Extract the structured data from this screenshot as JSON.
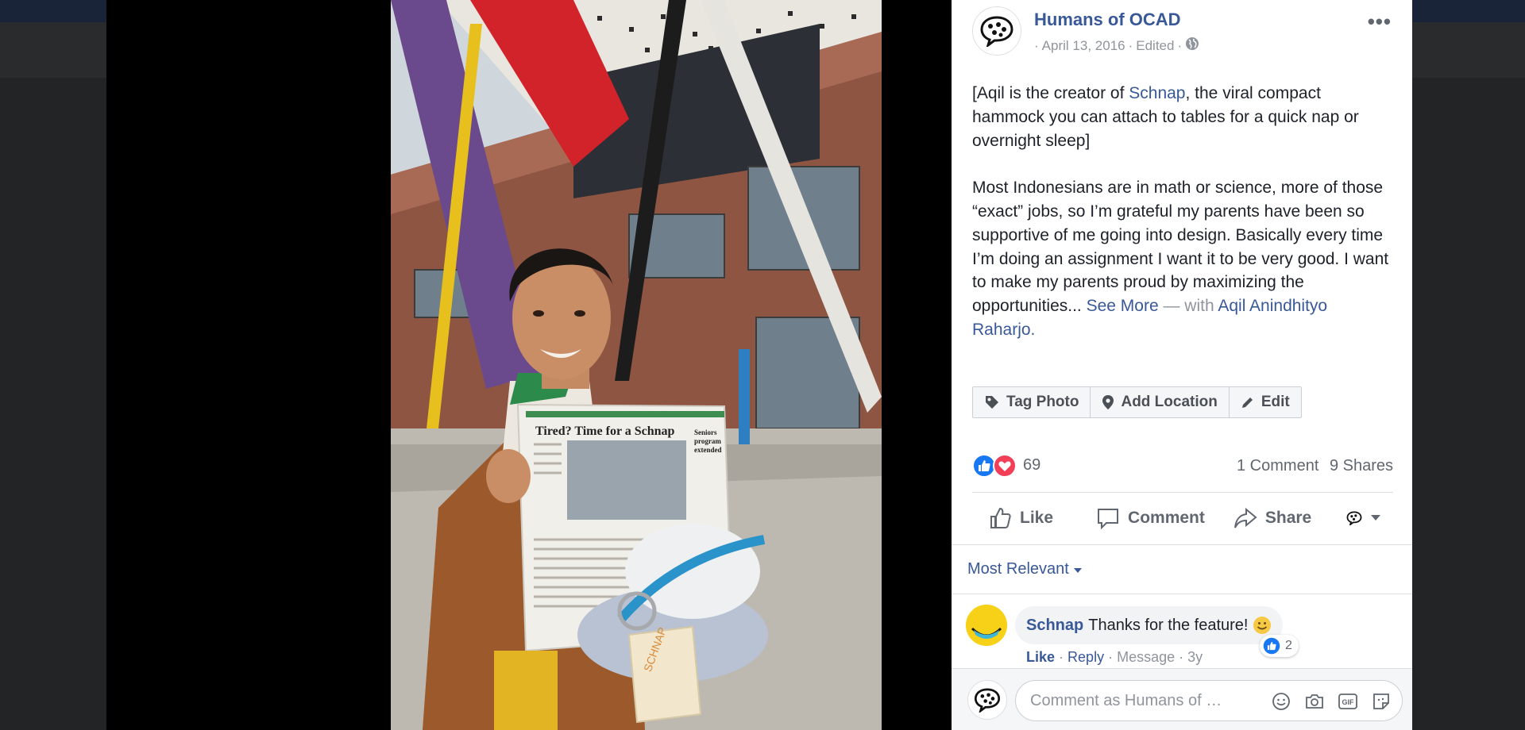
{
  "post": {
    "page_name": "Humans of OCAD",
    "date": "April 13, 2016",
    "edited": "Edited",
    "caption": {
      "p1_prefix": "[Aqil is the creator of ",
      "p1_link": "Schnap",
      "p1_suffix": ", the viral compact hammock you can attach to tables for a quick nap or overnight sleep]",
      "p2_text": "Most Indonesians are in math or science, more of those “exact” jobs, so I’m grateful my parents have been so supportive of me going into design. Basically every time I’m doing an assignment I want it to be very good. I want to make my parents proud by maximizing the opportunities... ",
      "see_more": "See More",
      "with_text": " — with ",
      "tagged_person": "Aqil Anindhityo Raharjo."
    }
  },
  "photo_actions": {
    "tag_photo": "Tag Photo",
    "add_location": "Add Location",
    "edit": "Edit"
  },
  "reactions": {
    "count": "69",
    "comments": "1 Comment",
    "shares": "9 Shares"
  },
  "actions": {
    "like": "Like",
    "comment": "Comment",
    "share": "Share"
  },
  "comments": {
    "sort_label": "Most Relevant",
    "items": [
      {
        "author": "Schnap",
        "text": "Thanks for the feature!",
        "reaction_count": "2",
        "like": "Like",
        "reply": "Reply",
        "message": "Message",
        "age": "3y"
      }
    ]
  },
  "composer": {
    "placeholder": "Comment as Humans of …"
  },
  "photo_text": {
    "headline": "Tired? Time for a Schnap",
    "side_headline": "Seniors program extended",
    "tag_text": "SCHNAP"
  },
  "colors": {
    "link": "#385898",
    "like_blue": "#1877f2",
    "love_red": "#f33e58"
  }
}
